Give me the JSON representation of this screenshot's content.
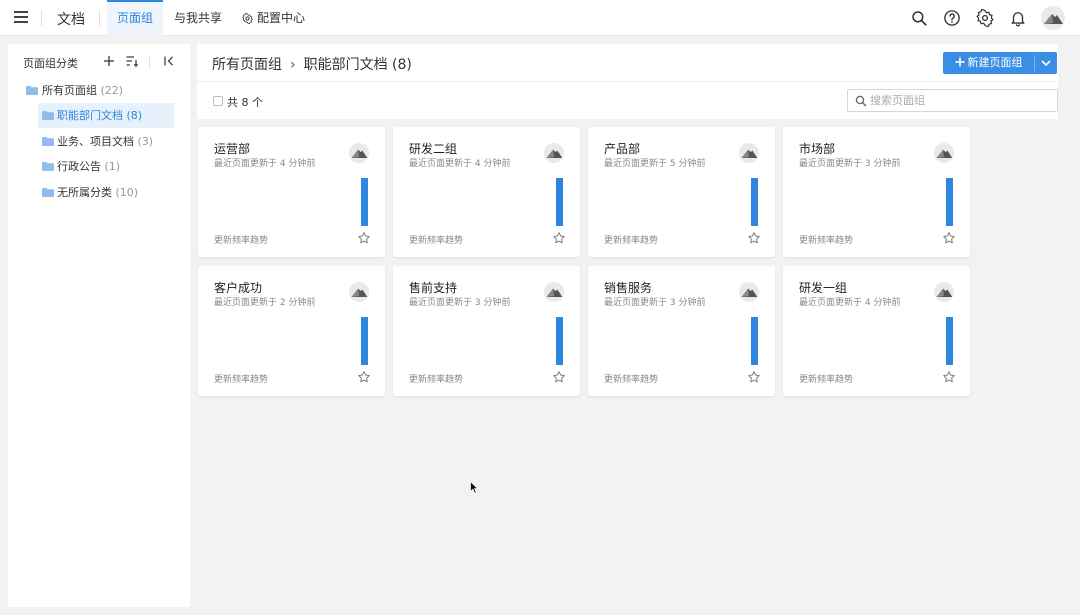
{
  "topbar": {
    "app_title": "文档",
    "tabs": [
      {
        "label": "页面组",
        "active": true
      },
      {
        "label": "与我共享",
        "active": false
      },
      {
        "label": "配置中心",
        "active": false,
        "icon": "gear-icon"
      }
    ],
    "icons": [
      "search-icon",
      "help-icon",
      "settings-icon",
      "bell-icon",
      "avatar"
    ]
  },
  "sidebar": {
    "title": "页面组分类",
    "tools": [
      "add-icon",
      "sort-icon",
      "collapse-icon"
    ],
    "items": [
      {
        "label": "所有页面组",
        "count": "(22)",
        "level": 0,
        "selected": false
      },
      {
        "label": "职能部门文档",
        "count": "(8)",
        "level": 1,
        "selected": true
      },
      {
        "label": "业务、项目文档",
        "count": "(3)",
        "level": 1,
        "selected": false
      },
      {
        "label": "行政公告",
        "count": "(1)",
        "level": 1,
        "selected": false
      },
      {
        "label": "无所属分类",
        "count": "(10)",
        "level": 1,
        "selected": false
      }
    ]
  },
  "main": {
    "breadcrumb": {
      "root": "所有页面组",
      "current": "职能部门文档 (8)"
    },
    "new_button": "新建页面组",
    "total": "共 8 个",
    "search_placeholder": "搜索页面组",
    "cards": [
      {
        "name": "运营部",
        "updated": "最近页面更新于 4 分钟前",
        "trend_label": "更新频率趋势"
      },
      {
        "name": "研发二组",
        "updated": "最近页面更新于 4 分钟前",
        "trend_label": "更新频率趋势"
      },
      {
        "name": "产品部",
        "updated": "最近页面更新于 5 分钟前",
        "trend_label": "更新频率趋势"
      },
      {
        "name": "市场部",
        "updated": "最近页面更新于 3 分钟前",
        "trend_label": "更新频率趋势"
      },
      {
        "name": "客户成功",
        "updated": "最近页面更新于 2 分钟前",
        "trend_label": "更新频率趋势"
      },
      {
        "name": "售前支持",
        "updated": "最近页面更新于 3 分钟前",
        "trend_label": "更新频率趋势"
      },
      {
        "name": "销售服务",
        "updated": "最近页面更新于 3 分钟前",
        "trend_label": "更新频率趋势"
      },
      {
        "name": "研发一组",
        "updated": "最近页面更新于 4 分钟前",
        "trend_label": "更新频率趋势"
      }
    ]
  },
  "colors": {
    "accent": "#2e86de",
    "button": "#3a8ee6",
    "folder": "#8fbcec",
    "background": "#f2f2f2"
  }
}
